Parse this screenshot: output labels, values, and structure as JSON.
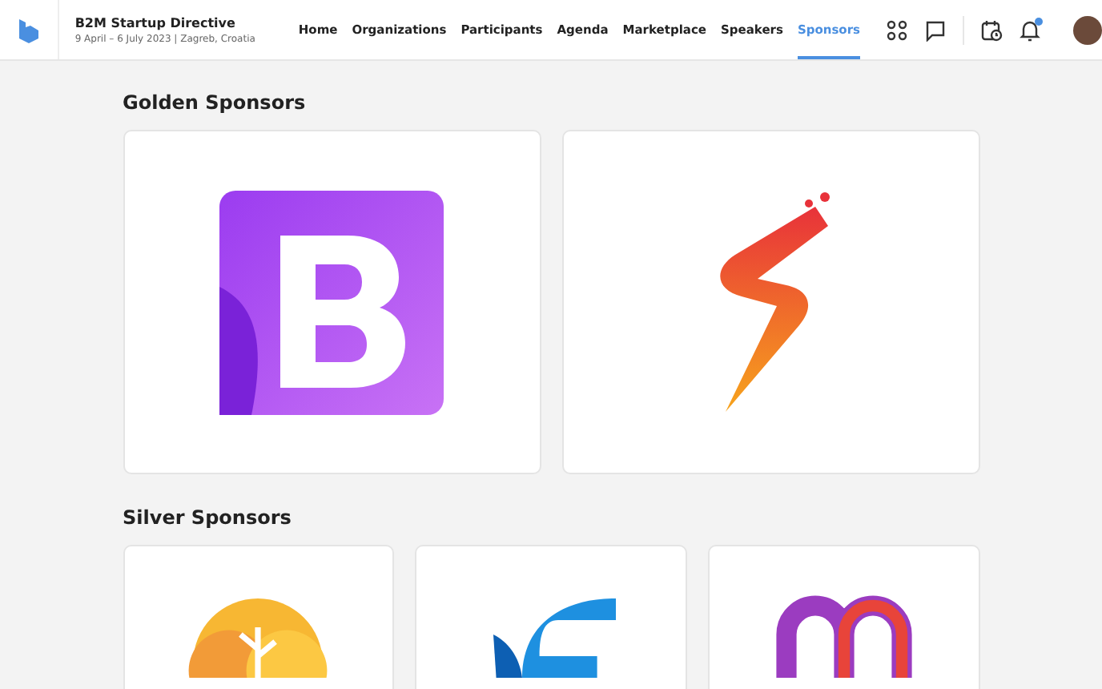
{
  "event": {
    "title": "B2M Startup Directive",
    "subtitle": "9 April – 6 July 2023 | Zagreb, Croatia"
  },
  "nav": [
    {
      "label": "Home",
      "selected": false
    },
    {
      "label": "Organizations",
      "selected": false
    },
    {
      "label": "Participants",
      "selected": false
    },
    {
      "label": "Agenda",
      "selected": false
    },
    {
      "label": "Marketplace",
      "selected": false
    },
    {
      "label": "Speakers",
      "selected": false
    },
    {
      "label": "Sponsors",
      "selected": true
    }
  ],
  "notifications": {
    "unread": true
  },
  "sections": [
    {
      "title": "Golden Sponsors",
      "kind": "large",
      "sponsors": [
        {
          "kind": "b-tile"
        },
        {
          "kind": "bolt"
        }
      ]
    },
    {
      "title": "Silver Sponsors",
      "kind": "small",
      "sponsors": [
        {
          "kind": "tree"
        },
        {
          "kind": "wing"
        },
        {
          "kind": "loop"
        }
      ]
    }
  ]
}
